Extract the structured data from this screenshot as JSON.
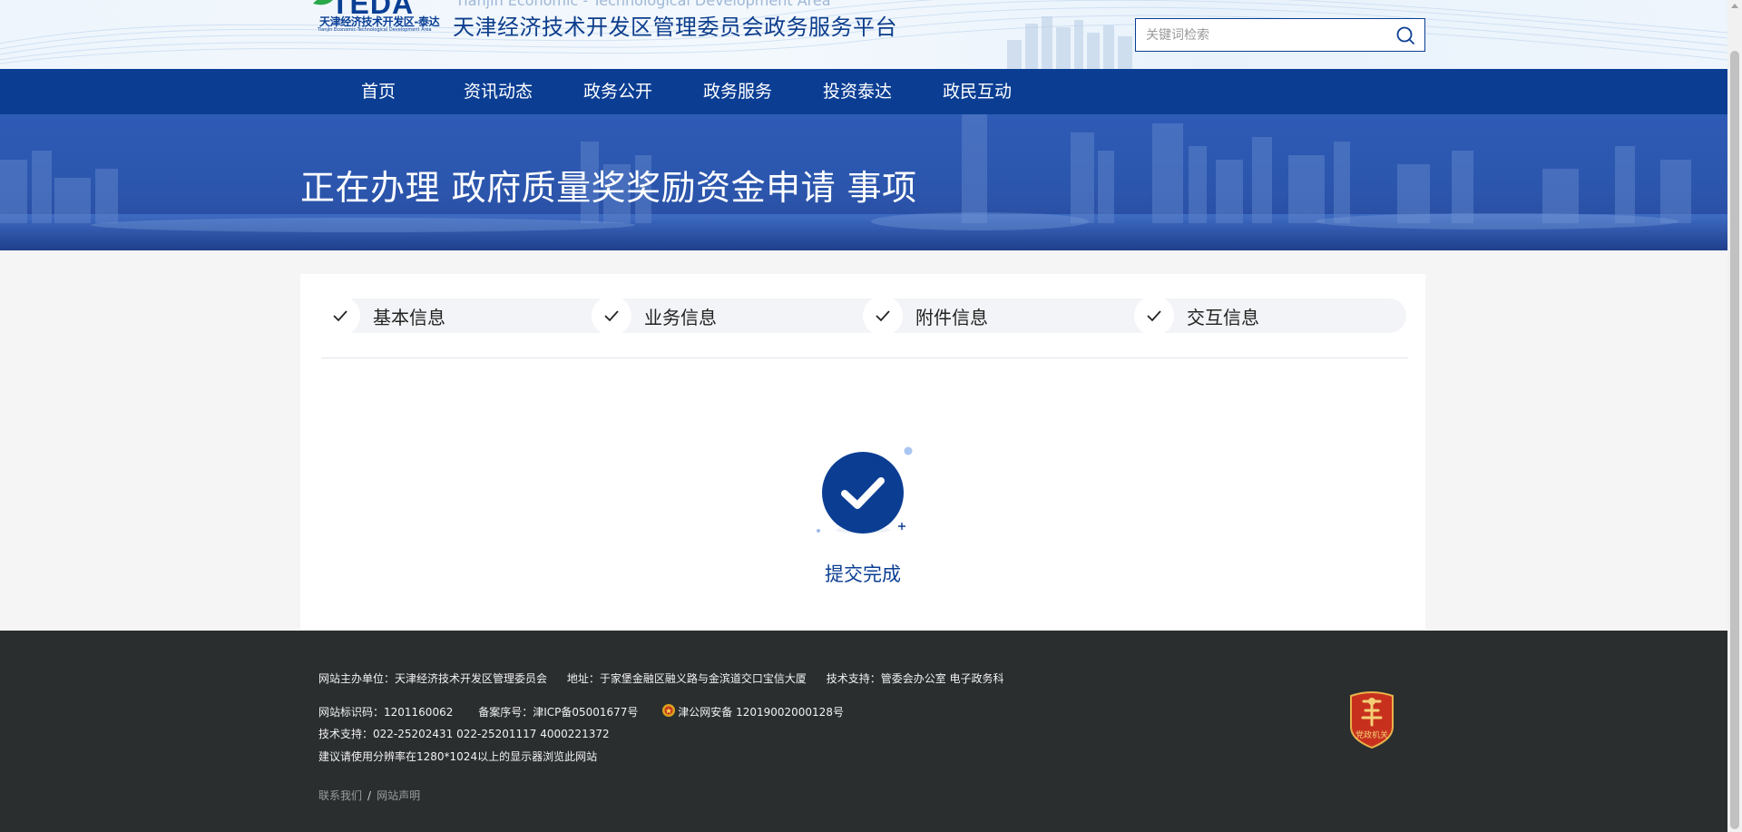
{
  "header": {
    "logo_text": "TEDA",
    "logo_cn": "天津经济技术开发区-泰达",
    "logo_en": "Tianjin Economic-Technological Development Area",
    "subtitle_en": "Tianjin Economic - Technological Development Area",
    "title": "天津经济技术开发区管理委员会政务服务平台",
    "search": {
      "placeholder": "关键词检索",
      "value": ""
    }
  },
  "nav": {
    "items": [
      {
        "label": "首页"
      },
      {
        "label": "资讯动态"
      },
      {
        "label": "政务公开"
      },
      {
        "label": "政务服务"
      },
      {
        "label": "投资泰达"
      },
      {
        "label": "政民互动"
      }
    ]
  },
  "banner": {
    "title": "正在办理 政府质量奖奖励资金申请 事项"
  },
  "steps": [
    {
      "label": "基本信息",
      "status": "done",
      "icon": "check-icon"
    },
    {
      "label": "业务信息",
      "status": "done",
      "icon": "check-icon"
    },
    {
      "label": "附件信息",
      "status": "done",
      "icon": "check-icon"
    },
    {
      "label": "交互信息",
      "status": "done",
      "icon": "check-icon"
    }
  ],
  "result": {
    "icon": "success-check-icon",
    "text": "提交完成"
  },
  "footer": {
    "sponsor": "网站主办单位：天津经济技术开发区管理委员会",
    "address": "地址：于家堡金融区融义路与金滨道交口宝信大厦",
    "tech_support_org": "技术支持：管委会办公室 电子政务科",
    "site_id": "网站标识码：1201160062",
    "icp": "备案序号：津ICP备05001677号",
    "police": "津公网安备 12019002000128号",
    "tech_phone": "技术支持：022-25202431 022-25201117 4000221372",
    "resolution_tip": "建议请使用分辨率在1280*1024以上的显示器浏览此网站",
    "links": [
      {
        "label": "联系我们"
      },
      {
        "label": "网站声明"
      }
    ],
    "link_separator": "/",
    "badge_label": "党政机关"
  },
  "colors": {
    "primary": "#0b3e93",
    "nav_bg": "#0b3e93",
    "footer_bg": "#2a2e2f",
    "page_bg": "#f5f5f6",
    "badge_red": "#c8301e"
  }
}
